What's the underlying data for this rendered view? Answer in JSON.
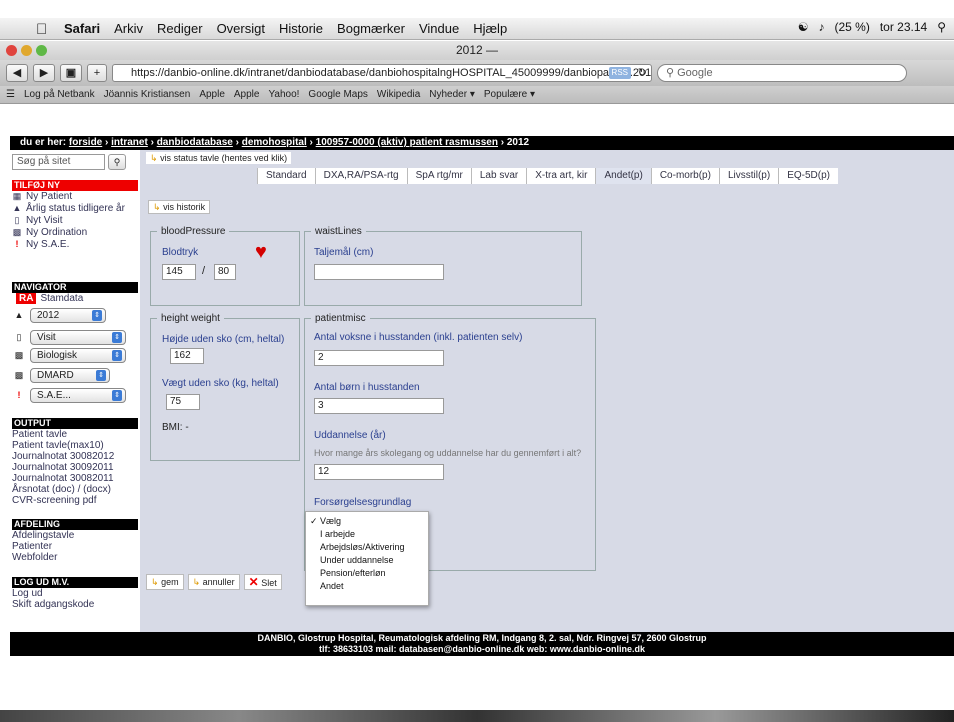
{
  "menubar": {
    "items": [
      "Safari",
      "Arkiv",
      "Rediger",
      "Oversigt",
      "Historie",
      "Bogmærker",
      "Vindue",
      "Hjælp"
    ],
    "battery": "(25 %)",
    "clock": "tor 23.14"
  },
  "window": {
    "title": "2012 —"
  },
  "toolbar": {
    "url": "https://danbio-online.dk/intranet/danbiodatabase/danbiohospitalngHOSPITAL_45009999/danbiopatient.2012-08-",
    "rss": "RSS",
    "search_placeholder": "Google"
  },
  "bookmarks": [
    "Log på Netbank",
    "Jöannis Kristiansen",
    "Apple",
    "Apple",
    "Yahoo!",
    "Google Maps",
    "Wikipedia",
    "Nyheder ▾",
    "Populære ▾"
  ],
  "breadcrumb": {
    "prefix": "du er her: ",
    "items": [
      "forside",
      "intranet",
      "danbiodatabase",
      "demohospital",
      "100957-0000 (aktiv) patient rasmussen"
    ],
    "last": "2012"
  },
  "sidebar": {
    "search_placeholder": "Søg på sitet",
    "tilfoj_head": "TILFØJ NY",
    "tilfoj_items": [
      "Ny Patient",
      "Årlig status tidligere år",
      "Nyt Visit",
      "Ny Ordination",
      "Ny S.A.E."
    ],
    "navigator_head": "NAVIGATOR",
    "ra_badge": "RA",
    "stamdata": "Stamdata",
    "selects": [
      "2012",
      "Visit",
      "Biologisk",
      "DMARD",
      "S.A.E..."
    ],
    "output_head": "OUTPUT",
    "output_items": [
      "Patient tavle",
      "Patient tavle(max10)",
      "Journalnotat 30082012",
      "Journalnotat 30092011",
      "Journalnotat 30082011",
      "Årsnotat (doc) / (docx)",
      "CVR-screening pdf"
    ],
    "afdeling_head": "AFDELING",
    "afdeling_items": [
      "Afdelingstavle",
      "Patienter",
      "Webfolder"
    ],
    "logud_head": "LOG UD M.V.",
    "logud_items": [
      "Log ud",
      "Skift adgangskode"
    ]
  },
  "main": {
    "status_tab": "vis status tavle (hentes ved klik)",
    "tabs": [
      "Standard",
      "DXA,RA/PSA-rtg",
      "SpA rtg/mr",
      "Lab svar",
      "X-tra art, kir",
      "Andet(p)",
      "Co-morb(p)",
      "Livsstil(p)",
      "EQ-5D(p)"
    ],
    "vis_historik": "vis historik",
    "blood": {
      "legend": "bloodPressure",
      "label": "Blodtryk",
      "sys": "145",
      "sep": "/",
      "dia": "80"
    },
    "waist": {
      "legend": "waistLines",
      "label": "Taljemål (cm)",
      "value": ""
    },
    "hw": {
      "legend": "height weight",
      "height_label": "Højde uden sko (cm, heltal)",
      "height": "162",
      "weight_label": "Vægt uden sko (kg, heltal)",
      "weight": "75",
      "bmi": "BMI: -"
    },
    "misc": {
      "legend": "patientmisc",
      "adults_label": "Antal voksne i husstanden (inkl. patienten selv)",
      "adults": "2",
      "children_label": "Antal børn i husstanden",
      "children": "3",
      "edu_label": "Uddannelse (år)",
      "edu_hint": "Hvor mange års skolegang og uddannelse har du gennemført i alt?",
      "edu": "12",
      "support_label": "Forsørgelsesgrundlag"
    },
    "buttons": {
      "gem": "gem",
      "annuller": "annuller",
      "slet": "Slet"
    }
  },
  "dropdown": {
    "options": [
      "✓ Vælg",
      "I arbejde",
      "Arbejdsløs/Aktivering",
      "Under uddannelse",
      "Pension/efterløn",
      "Andet"
    ]
  },
  "footer": {
    "line1": "DANBIO, Glostrup Hospital, Reumatologisk afdeling RM, Indgang 8, 2. sal, Ndr. Ringvej 57, 2600 Glostrup",
    "line2": "tlf: 38633103 mail: databasen@danbio-online.dk web: www.danbio-online.dk"
  },
  "colors": {
    "accent_red": "#e00000",
    "panel_bg": "#d7dae6",
    "label_blue": "#2a3f8f"
  }
}
